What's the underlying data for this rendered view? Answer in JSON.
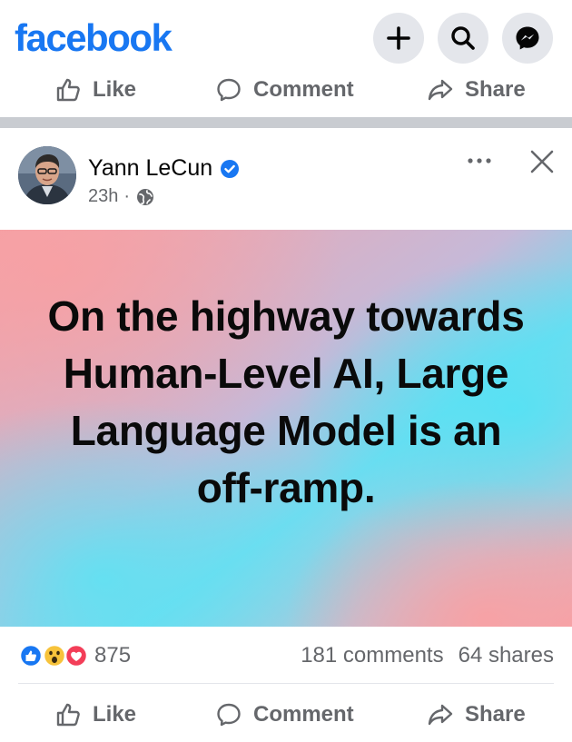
{
  "app": {
    "logo_text": "facebook",
    "brand_color": "#1877f2",
    "top_buttons": [
      {
        "icon": "plus-icon"
      },
      {
        "icon": "search-icon"
      },
      {
        "icon": "messenger-icon"
      }
    ]
  },
  "actions": {
    "like_label": "Like",
    "comment_label": "Comment",
    "share_label": "Share"
  },
  "post": {
    "author": "Yann LeCun",
    "verified": true,
    "time": "23h",
    "separator": "·",
    "audience_icon": "globe-icon",
    "text": "On the highway towards Human-Level AI, Large Language Model is an off-ramp.",
    "background_colors": [
      "#f6a2a7",
      "#5de3f2",
      "#f6a2a7"
    ]
  },
  "stats": {
    "reaction_icons": [
      "like-reaction-icon",
      "wow-reaction-icon",
      "love-reaction-icon"
    ],
    "reaction_count": "875",
    "comments": "181 comments",
    "shares": "64 shares"
  }
}
